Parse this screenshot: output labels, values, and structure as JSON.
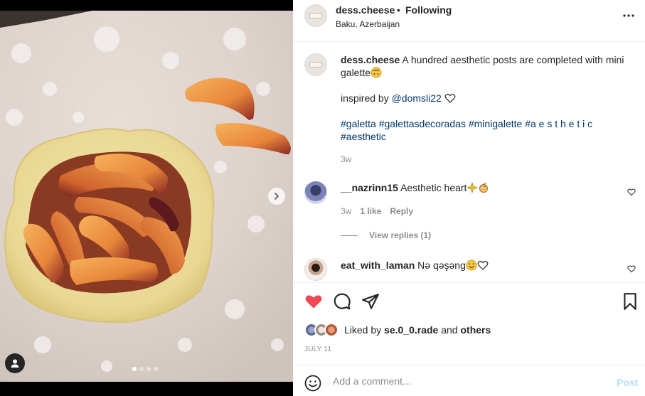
{
  "post": {
    "author": "dess.cheese",
    "separator": "•",
    "follow_status": "Following",
    "location": "Baku, Azerbaijan",
    "more_icon": "more-horizontal-icon"
  },
  "caption": {
    "username": "dess.cheese",
    "text": "A hundred aesthetic posts are completed with mini galette",
    "emoji": "upside-down-face-icon",
    "inspired_prefix": "inspired by",
    "mention": "@domsli22",
    "hashtags": [
      "#galetta",
      "#galettasdecoradas",
      "#minigalette",
      "#a e s t h e t i c",
      "#aesthetic"
    ],
    "time": "3w"
  },
  "comments": [
    {
      "username": "__nazrinn15",
      "text": "Aesthetic heart",
      "emojis": [
        "sparkle-hands-icon",
        "ok-hand-icon"
      ],
      "time": "3w",
      "likes": "1 like",
      "reply_label": "Reply",
      "view_replies": "View replies (1)"
    },
    {
      "username": "eat_with_laman",
      "text": "Nə qəşəng",
      "emojis": [
        "smiling-face-icon",
        "white-heart-icon"
      ]
    }
  ],
  "likes": {
    "prefix": "Liked by",
    "user": "se.0_0.rade",
    "conjunction": "and",
    "others": "others"
  },
  "date": "JULY 11",
  "add_comment": {
    "placeholder": "Add a comment...",
    "post_label": "Post"
  },
  "carousel": {
    "slide_count": 4,
    "active_slide": 1
  },
  "colors": {
    "like_red": "#ed4956",
    "link_blue": "#00376b",
    "muted": "#8e8e8e",
    "post_disabled": "#b2dffc"
  }
}
